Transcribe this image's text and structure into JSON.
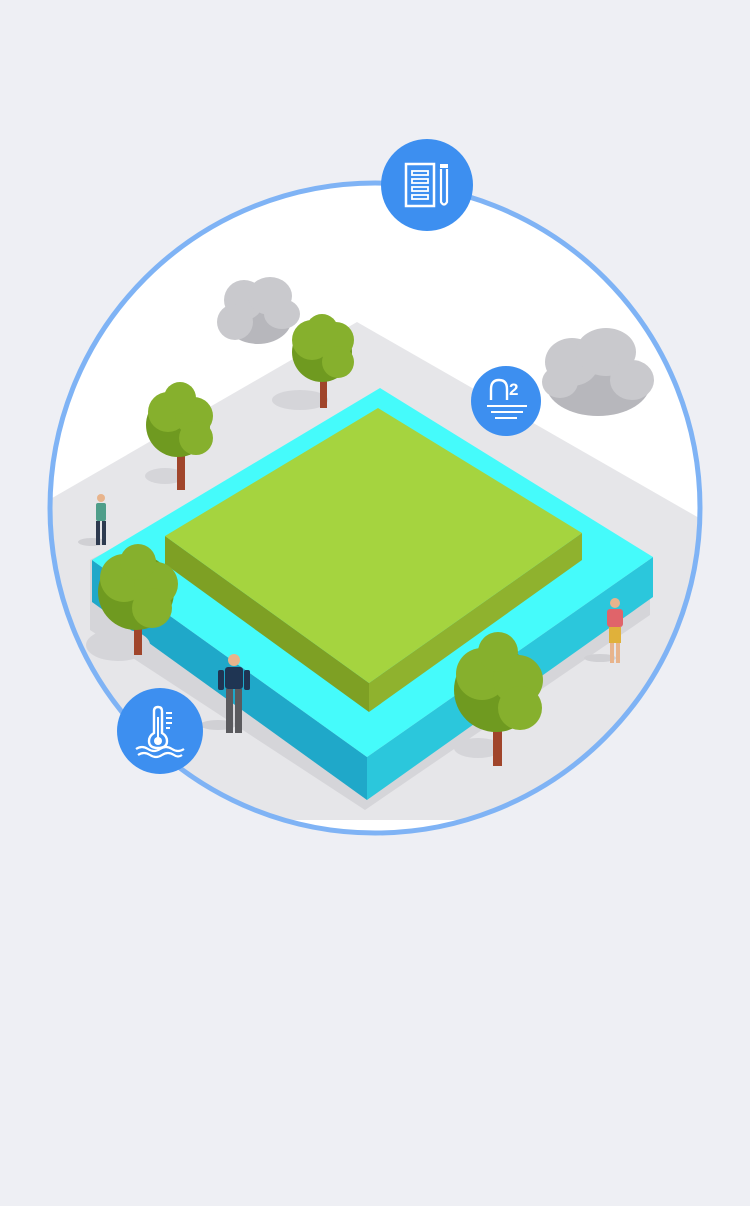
{
  "scene": {
    "colors": {
      "page_background": "#eeeff4",
      "circle_fill": "#ffffff",
      "circle_border": "#7fb3f5",
      "ground": "#e6e6e9",
      "water_top": "#45fbfb",
      "water_side_dark": "#1fa8c9",
      "water_side_light": "#2bc7dc",
      "field_top": "#a5d43f",
      "field_side_dark": "#7ea024",
      "field_side_light": "#8fb22e",
      "tree_leaf": "#86b02d",
      "tree_leaf_dark": "#6f9a20",
      "tree_trunk": "#a0452b",
      "cloud": "#c4c4c8",
      "badge": "#3d8ff0"
    },
    "badges": {
      "lab": {
        "icon": "lab-report-icon"
      },
      "oxygen": {
        "icon": "dissolved-oxygen-icon",
        "subscript": "2"
      },
      "temperature": {
        "icon": "water-temperature-icon"
      }
    }
  }
}
